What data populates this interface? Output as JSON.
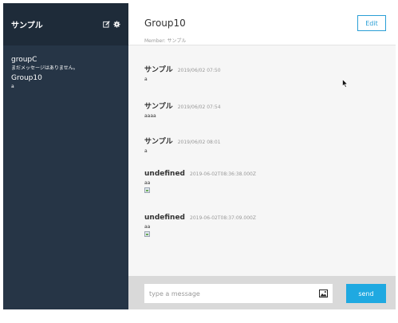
{
  "sidebar": {
    "user_name": "サンプル",
    "edit_icon": "edit-icon",
    "settings_icon": "gear-icon",
    "groups": [
      {
        "name": "groupC",
        "last_message": "まだメッセージはありません。"
      },
      {
        "name": "Group10",
        "last_message": "a"
      }
    ]
  },
  "main": {
    "group_name": "Group10",
    "member_label": "Member: ",
    "members": "サンプル",
    "edit_label": "Edit",
    "messages": [
      {
        "user": "サンプル",
        "date": "2019/06/02 07:50",
        "text": "a",
        "has_image": false
      },
      {
        "user": "サンプル",
        "date": "2019/06/02 07:54",
        "text": "aaaa",
        "has_image": false
      },
      {
        "user": "サンプル",
        "date": "2019/06/02 08:01",
        "text": "a",
        "has_image": false
      },
      {
        "user": "undefined",
        "date": "2019-06-02T08:36:38.000Z",
        "text": "aa",
        "has_image": true
      },
      {
        "user": "undefined",
        "date": "2019-06-02T08:37:09.000Z",
        "text": "aa",
        "has_image": true
      }
    ]
  },
  "footer": {
    "placeholder": "type a message",
    "image_icon": "image-icon",
    "send_label": "send"
  },
  "colors": {
    "sidebar_bg": "#263546",
    "sidebar_header_bg": "#1e2b39",
    "accent": "#2a9fd6",
    "send_bg": "#1fa9e1"
  }
}
